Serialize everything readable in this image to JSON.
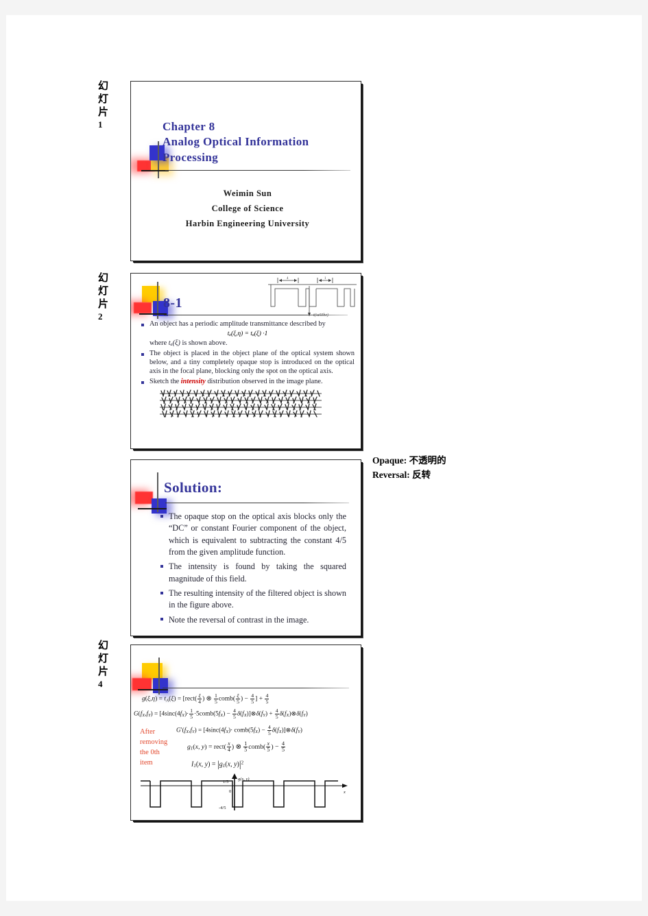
{
  "document": {
    "type": "lecture-slide-handout",
    "page_background": "#ffffff",
    "canvas_background": "#f4f4f4",
    "accent_color": "#333399",
    "highlight_color": "#cc0000",
    "note_color": "#e2462b"
  },
  "slide_labels": [
    {
      "cjk": [
        "幻",
        "灯",
        "片"
      ],
      "number": "1"
    },
    {
      "cjk": [
        "幻",
        "灯",
        "片"
      ],
      "number": "2"
    },
    {
      "cjk": [
        "幻",
        "灯",
        "片"
      ],
      "number": "4"
    }
  ],
  "slide1": {
    "title_line1": "Chapter  8",
    "title_line2": "Analog  Optical  Information",
    "title_line3": "Processing",
    "presenter_name": "Weimin  Sun",
    "presenter_dept": "College  of  Science",
    "presenter_org": "Harbin  Engineering  University"
  },
  "slide2": {
    "title": "8-1",
    "bullet1": "An object has a periodic amplitude transmittance described by",
    "equation1": "tₐ(ξ,η) = tₐ(ξ) ·1",
    "subline1_pre": "where ",
    "subline1_eq": "tₐ(ξ)",
    "subline1_post": " is  shown  above.",
    "bullet2": "The object is placed in the object plane of the optical system shown below, and a tiny completely opaque stop is introduced on the optical axis in the focal plane, blocking only the spot on the optical axis.",
    "bullet3_pre": "Sketch  the ",
    "bullet3_hl": "intensity",
    "bullet3_post": " distribution  observed  in  the  image  plane.",
    "figure_caption": "tₐ(ξ)",
    "figure_label_left": "4",
    "figure_label_right": "1",
    "annotation_overwrite": "dense handwritten annotation block (illegible)"
  },
  "slide3": {
    "title": "Solution:",
    "bullets": [
      "The opaque stop on the optical axis blocks only the “DC” or constant Fourier component of the object, which is equivalent to subtracting the constant 4/5 from the given amplitude function.",
      "The intensity is found by taking the squared magnitude of this field.",
      "The resulting intensity of the filtered object is shown in the figure above.",
      "Note the reversal of contrast in the image."
    ]
  },
  "side_notes": [
    {
      "term": "Opaque:",
      "translation": "不透明的"
    },
    {
      "term": "Reversal:",
      "translation": "反转"
    }
  ],
  "slide4": {
    "note": [
      "After",
      "removing",
      "the  0th",
      "item"
    ],
    "equations": [
      {
        "id": "eq-g",
        "lhs": "g(ξ,η) = tₐ(ξ) =",
        "rhs": "[rect(ξ/4) ⊗ (1/5)comb(ξ/5) − 4/5] + 4/5"
      },
      {
        "id": "eq-G",
        "lhs": "G(fₓ,fᵧ) =",
        "rhs": "[4sinc(4fₓ) · (1/5) · 5comb(5fₓ) − (4/5)δ(fₓ)] ⊗ δ(fᵧ) + (4/5)δ(fₓ) ⊗ δ(fᵧ)"
      },
      {
        "id": "eq-Gprime",
        "lhs": "G′(fₓ,fᵧ) =",
        "rhs": "[4sinc(4fₓ) · comb(5fₓ) − (4/5)δ(fₓ)] ⊗ δ(fᵧ)"
      },
      {
        "id": "eq-g1",
        "lhs": "g₁(x, y) =",
        "rhs": "rect(x/4) ⊗ (1/5)comb(x/5) − 4/5"
      },
      {
        "id": "eq-I",
        "lhs": "I₁(x, y) =",
        "rhs": "|g₁(x, y)|²"
      }
    ],
    "plot": {
      "type": "line",
      "title": "g(x, y)",
      "xlabel": "x",
      "ylabel": "g(x, y)",
      "tick_labels": [
        "1/5",
        "0",
        "-4/5"
      ],
      "high_level": "1/5",
      "low_level": "-4/5",
      "baseline": "0",
      "description": "Periodic square wave alternating between 1/5 (wide high plateaus) and -4/5 (narrow low troughs), 5 periods shown",
      "values": [
        0.2,
        -0.8,
        0.2,
        -0.8,
        0.2,
        -0.8,
        0.2,
        -0.8,
        0.2,
        -0.8
      ],
      "ylim": [
        -0.8,
        0.2
      ],
      "grid": false
    }
  }
}
